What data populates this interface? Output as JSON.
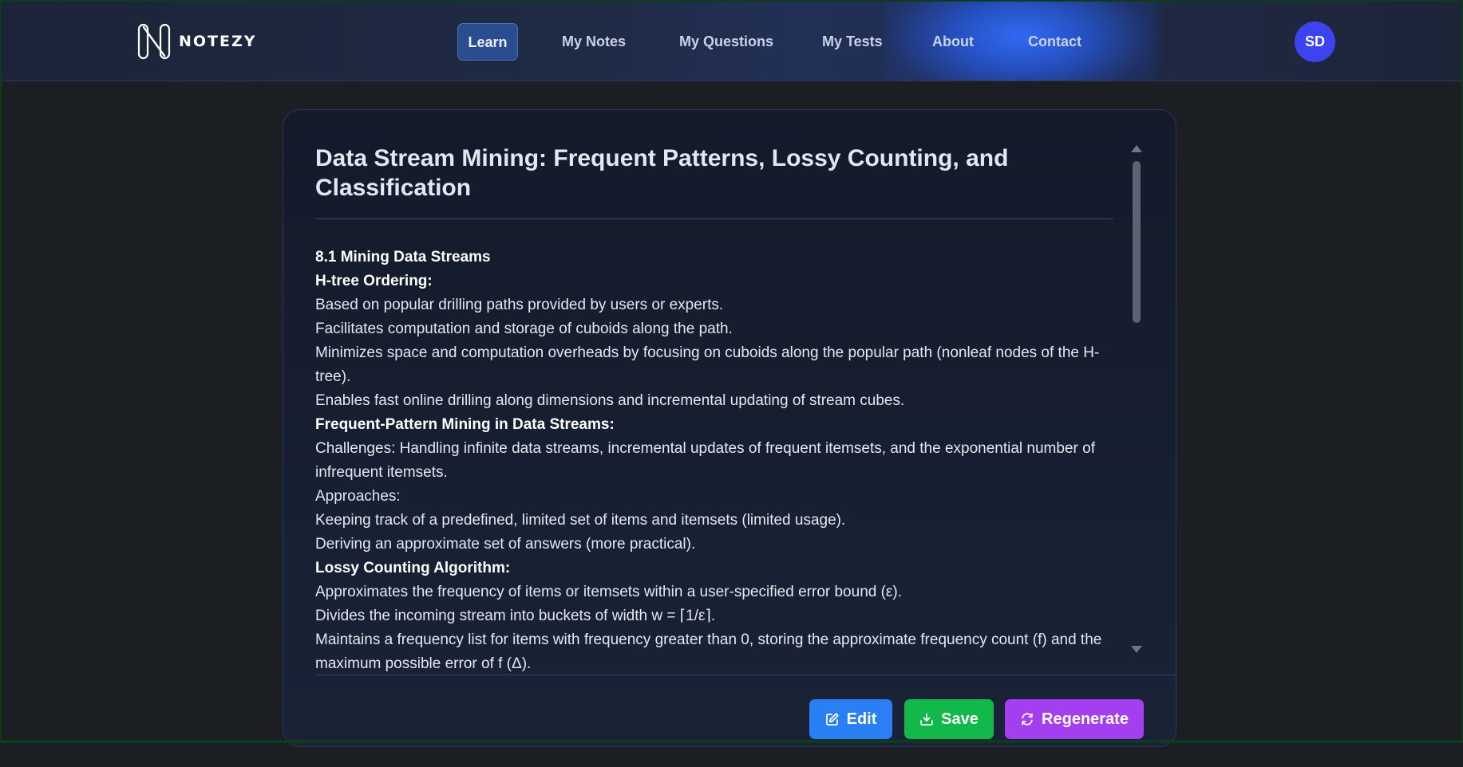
{
  "brand": {
    "name": "NOTEZY"
  },
  "nav": {
    "items": [
      {
        "label": "Learn",
        "active": true
      },
      {
        "label": "My Notes",
        "active": false
      },
      {
        "label": "My Questions",
        "active": false
      },
      {
        "label": "My Tests",
        "active": false
      },
      {
        "label": "About",
        "active": false
      },
      {
        "label": "Contact",
        "active": false
      }
    ],
    "avatar_initials": "SD"
  },
  "note": {
    "title": "Data Stream Mining: Frequent Patterns, Lossy Counting, and Classification",
    "lines": [
      {
        "text": "8.1 Mining Data Streams",
        "bold": true
      },
      {
        "text": "H-tree Ordering:",
        "bold": true
      },
      {
        "text": "Based on popular drilling paths provided by users or experts.",
        "bold": false
      },
      {
        "text": "Facilitates computation and storage of cuboids along the path.",
        "bold": false
      },
      {
        "text": "Minimizes space and computation overheads by focusing on cuboids along the popular path (nonleaf nodes of the H-tree).",
        "bold": false
      },
      {
        "text": "Enables fast online drilling along dimensions and incremental updating of stream cubes.",
        "bold": false
      },
      {
        "text": "Frequent-Pattern Mining in Data Streams:",
        "bold": true
      },
      {
        "text": "Challenges: Handling infinite data streams, incremental updates of frequent itemsets, and the exponential number of infrequent itemsets.",
        "bold": false
      },
      {
        "text": "Approaches:",
        "bold": false
      },
      {
        "text": "Keeping track of a predefined, limited set of items and itemsets (limited usage).",
        "bold": false
      },
      {
        "text": "Deriving an approximate set of answers (more practical).",
        "bold": false
      },
      {
        "text": "Lossy Counting Algorithm:",
        "bold": true
      },
      {
        "text": "Approximates the frequency of items or itemsets within a user-specified error bound (ε).",
        "bold": false
      },
      {
        "text": "Divides the incoming stream into buckets of width w = ⌈1/ε⌉.",
        "bold": false
      },
      {
        "text": "Maintains a frequency list for items with frequency greater than 0, storing the approximate frequency count (f) and the maximum possible error of f (Δ).",
        "bold": false
      }
    ]
  },
  "actions": {
    "edit_label": "Edit",
    "save_label": "Save",
    "regenerate_label": "Regenerate"
  },
  "colors": {
    "accent": "#2a4d8f",
    "edit": "#2a7ff4",
    "save": "#12b84a",
    "regenerate": "#a43ff0",
    "avatar": "#3b44ee"
  },
  "icons": {
    "edit": "edit-icon",
    "save": "download-icon",
    "regenerate": "refresh-icon"
  }
}
